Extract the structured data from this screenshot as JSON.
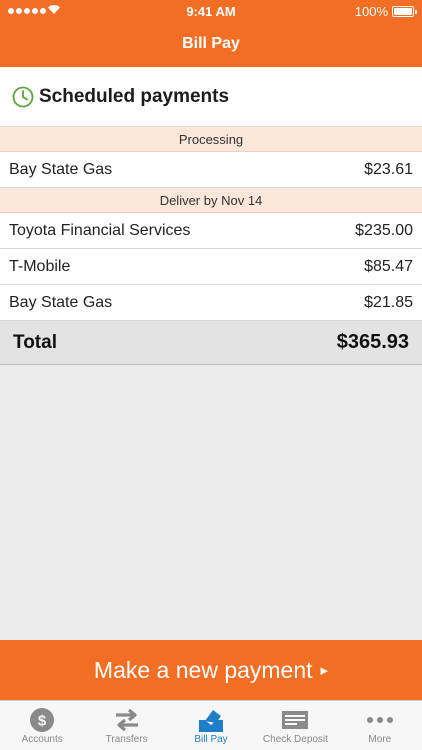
{
  "status_bar": {
    "time": "9:41 AM",
    "battery": "100%"
  },
  "header": {
    "title": "Bill Pay"
  },
  "section": {
    "title": "Scheduled payments"
  },
  "groups": [
    {
      "label": "Processing",
      "payments": [
        {
          "payee": "Bay State Gas",
          "amount": "$23.61"
        }
      ]
    },
    {
      "label": "Deliver by Nov 14",
      "payments": [
        {
          "payee": "Toyota Financial Services",
          "amount": "$235.00"
        },
        {
          "payee": "T-Mobile",
          "amount": "$85.47"
        },
        {
          "payee": "Bay State Gas",
          "amount": "$21.85"
        }
      ]
    }
  ],
  "total": {
    "label": "Total",
    "amount": "$365.93"
  },
  "cta": {
    "label": "Make a new payment",
    "arrow": "▸"
  },
  "tabs": [
    {
      "label": "Accounts",
      "icon": "dollar-coin-icon"
    },
    {
      "label": "Transfers",
      "icon": "transfer-arrows-icon"
    },
    {
      "label": "Bill Pay",
      "icon": "bill-envelope-icon",
      "active": true
    },
    {
      "label": "Check Deposit",
      "icon": "check-icon"
    },
    {
      "label": "More",
      "icon": "ellipsis-icon"
    }
  ],
  "colors": {
    "brand": "#f26e24",
    "active_tab": "#1e7fc6",
    "clock": "#5aa43a"
  }
}
